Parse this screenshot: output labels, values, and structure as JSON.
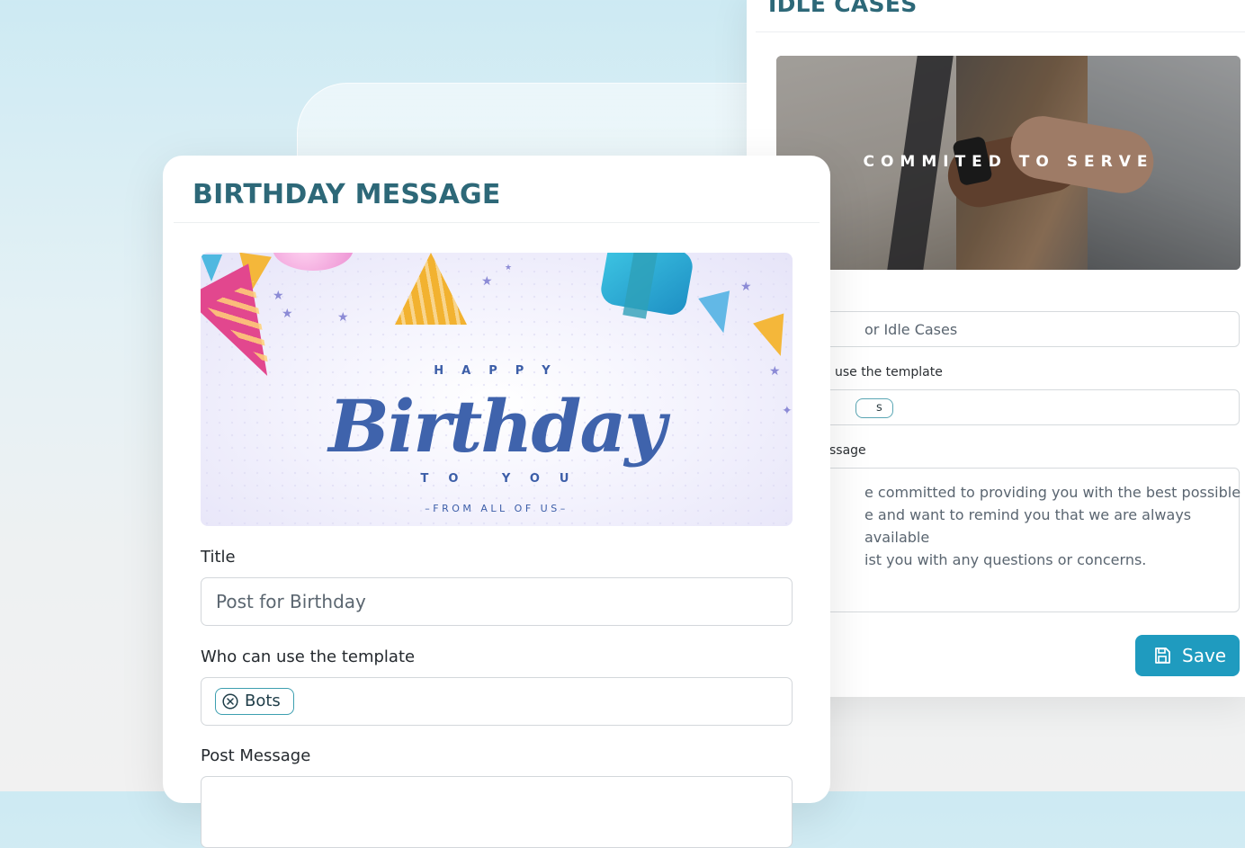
{
  "idle_card": {
    "title": "IDLE CASES",
    "photo_caption": "COMMITED TO SERVE",
    "title_value": "or Idle Cases",
    "who_label": "use the template",
    "chip_label": "s",
    "message_label": "ssage",
    "message_value": "e committed to providing you with the best possible\ne and want to remind you that we are always available\nist you with any questions or concerns.",
    "save_label": "Save"
  },
  "birthday_card": {
    "title": "BIRTHDAY MESSAGE",
    "banner": {
      "happy": "HAPPY",
      "birthday": "Birthday",
      "to_you": "TO YOU",
      "from": "–FROM ALL OF US–"
    },
    "title_label": "Title",
    "title_value": "Post for Birthday",
    "who_label": "Who can use the template",
    "chip_label": "Bots",
    "message_label": "Post Message"
  },
  "colors": {
    "heading": "#2d6878",
    "accent": "#1f9bbf",
    "chip_border": "#3d9fb0",
    "banner_text": "#3f63ac"
  },
  "icons": [
    "save-icon",
    "close-circle-icon"
  ]
}
